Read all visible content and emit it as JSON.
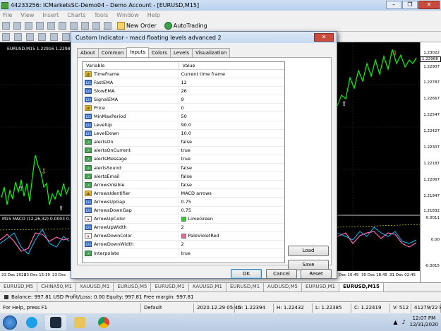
{
  "window": {
    "title": "44233256: ICMarketsSC-Demo04 - Demo Account - [EURUSD,M15]",
    "controls": [
      "–",
      "❐",
      "✕"
    ]
  },
  "menu": [
    "File",
    "View",
    "Insert",
    "Charts",
    "Tools",
    "Window",
    "Help"
  ],
  "toolbar": {
    "new_order": "New Order",
    "autotrading": "AutoTrading"
  },
  "chart": {
    "symbol_label": "EURUSD,M15  1.22916 1.22989 1.",
    "macd_label": "M15 MACD (12,26,32) 0.0003 0.0001",
    "prices": [
      "1.23022",
      "1.22968",
      "1.22907",
      "1.22787",
      "1.22667",
      "1.22547",
      "1.22427",
      "1.22307",
      "1.22187",
      "1.22067",
      "1.21947",
      "1.21832"
    ],
    "current_price": "1.22968",
    "macd_axis": [
      "0.0011",
      "0.00",
      "-0.0015"
    ],
    "time_labels_left": [
      "23 Dec 2020",
      "23 Dec 15:30",
      "23 Dec"
    ],
    "time_labels_right": [
      "Dec 10:45",
      "30 Dec 18:45",
      "31 Dec 02:45"
    ]
  },
  "dialog": {
    "title": "Custom Indicator - macd floating levels advanced 2",
    "close": "✕",
    "tabs": [
      "About",
      "Common",
      "Inputs",
      "Colors",
      "Levels",
      "Visualization"
    ],
    "active_tab": "Inputs",
    "columns": {
      "variable": "Variable",
      "value": "Value"
    },
    "rows": [
      {
        "type": "ab",
        "variable": "TimeFrame",
        "value": "Current time frame"
      },
      {
        "type": "num",
        "variable": "FastEMA",
        "value": "12"
      },
      {
        "type": "num",
        "variable": "SlowEMA",
        "value": "26"
      },
      {
        "type": "num",
        "variable": "SignalEMA",
        "value": "9"
      },
      {
        "type": "ab",
        "variable": "Price",
        "value": "0"
      },
      {
        "type": "num",
        "variable": "MinMaxPeriod",
        "value": "50"
      },
      {
        "type": "num",
        "variable": "LevelUp",
        "value": "90.0"
      },
      {
        "type": "num",
        "variable": "LevelDown",
        "value": "10.0"
      },
      {
        "type": "bool",
        "variable": "alertsOn",
        "value": "false"
      },
      {
        "type": "bool",
        "variable": "alertsOnCurrent",
        "value": "true"
      },
      {
        "type": "bool",
        "variable": "alertsMessage",
        "value": "true"
      },
      {
        "type": "bool",
        "variable": "alertsSound",
        "value": "false"
      },
      {
        "type": "bool",
        "variable": "alertsEmail",
        "value": "false"
      },
      {
        "type": "bool",
        "variable": "ArrowsVisible",
        "value": "false"
      },
      {
        "type": "ab",
        "variable": "ArrowsIdentifier",
        "value": "MACD arrows"
      },
      {
        "type": "num",
        "variable": "ArrowsUpGap",
        "value": "0.75"
      },
      {
        "type": "num",
        "variable": "ArrowsDownGap",
        "value": "0.75"
      },
      {
        "type": "col",
        "variable": "ArrowUpColor",
        "value": "LimeGreen",
        "swatch": "#32cd32"
      },
      {
        "type": "num",
        "variable": "ArrowUpWidth",
        "value": "2"
      },
      {
        "type": "col",
        "variable": "ArrowDownColor",
        "value": "PaleVioletRed",
        "swatch": "#db7093"
      },
      {
        "type": "num",
        "variable": "ArrowDownWidth",
        "value": "2"
      },
      {
        "type": "bool",
        "variable": "Interpolate",
        "value": "true"
      }
    ],
    "type_icons": {
      "ab": "ab",
      "num": "123",
      "bool": "↗",
      "col": "◆"
    },
    "load": "Load",
    "save": "Save",
    "ok": "OK",
    "cancel": "Cancel",
    "reset": "Reset"
  },
  "symbol_tabs": [
    "EURUSD,M5",
    "CHINA50,M1",
    "XAUUSD,M1",
    "EURUSD,M5",
    "EURUSD,M1",
    "XAUUSD,M1",
    "EURUSD,M1",
    "AUDUSD,M5",
    "EURUSD,M1",
    "EURUSD,M15"
  ],
  "active_symbol_tab": "EURUSD,M15",
  "balance_line": "Balance: 997.81 USD  Profit/Loss: 0.00  Equity: 997.81  Free margin: 997.81",
  "status": {
    "help": "For Help, press F1",
    "profile": "Default",
    "datetime": "2020.12.29 05:45",
    "open": "O: 1.22394",
    "high": "H: 1.22432",
    "low": "L: 1.22385",
    "close": "C: 1.22419",
    "volume": "V: 512",
    "traffic": "41279/22 kb"
  },
  "taskbar": {
    "time": "12:07 PM",
    "date": "12/31/2020"
  }
}
